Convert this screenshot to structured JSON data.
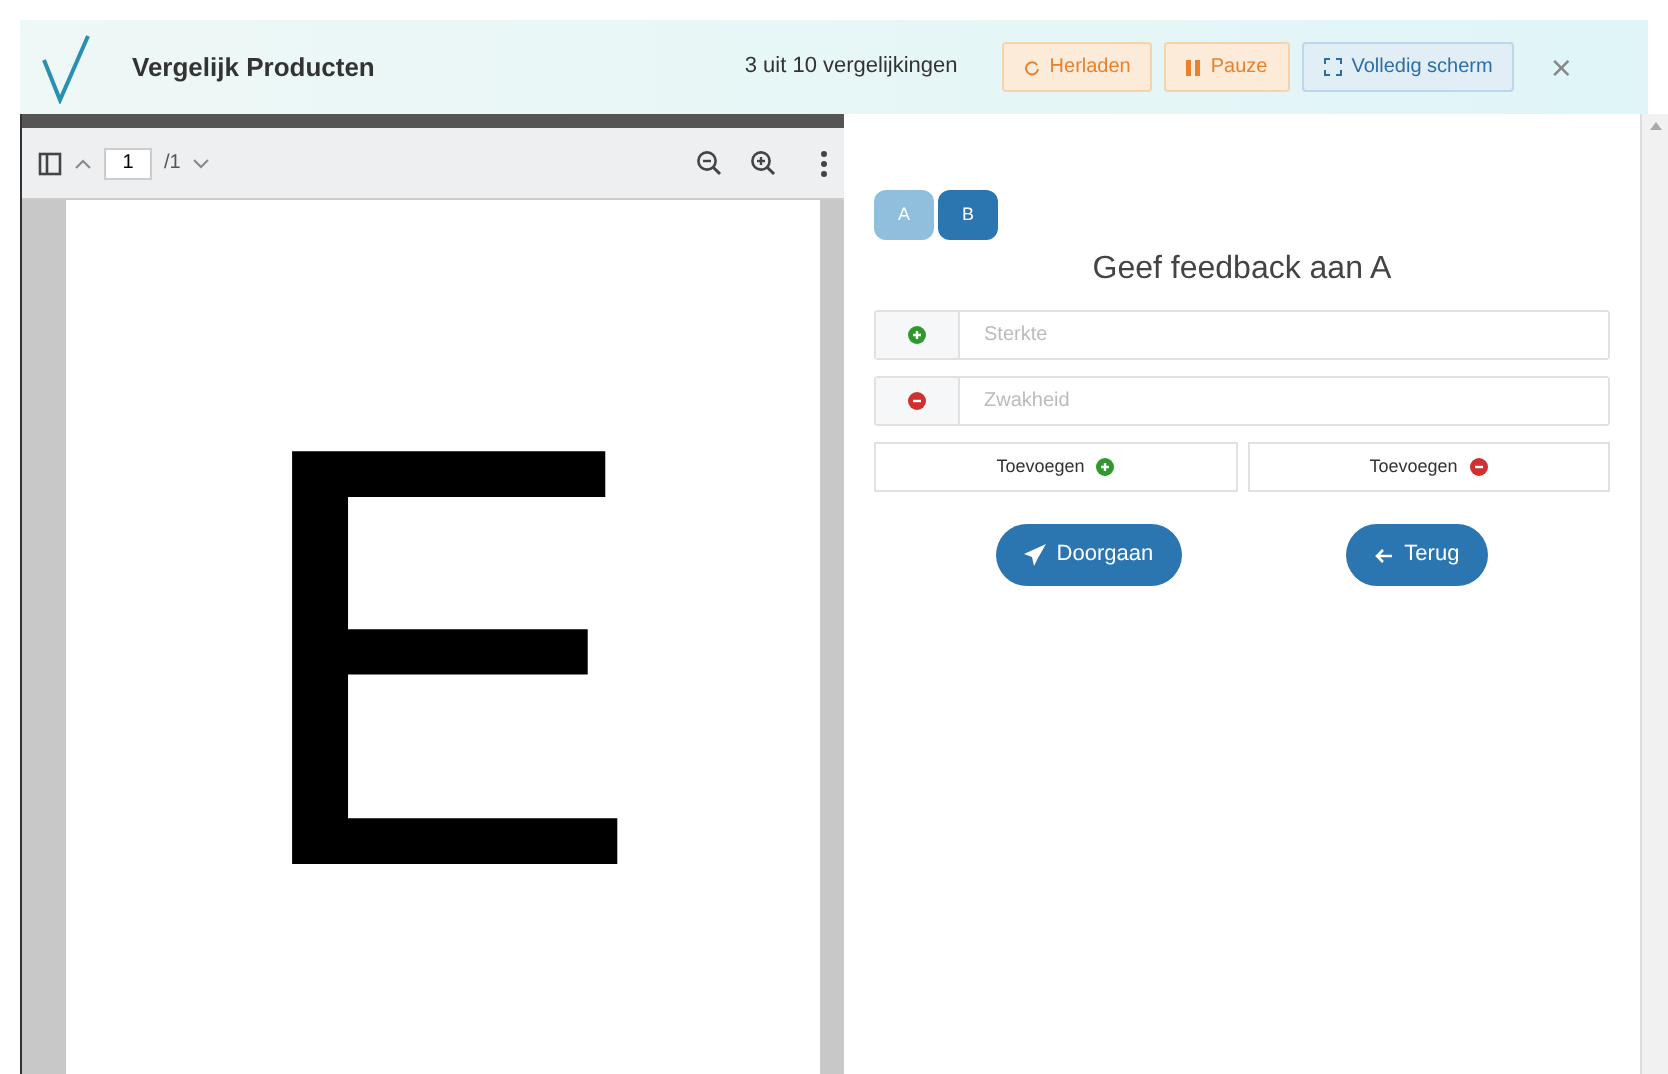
{
  "header": {
    "title": "Vergelijk Producten",
    "progress": "3 uit 10 vergelijkingen",
    "buttons": [
      {
        "kind": "reload",
        "label": "Herladen"
      },
      {
        "kind": "pause",
        "label": "Pauze"
      },
      {
        "kind": "fullscreen",
        "label": "Volledig scherm"
      }
    ],
    "close": "×"
  },
  "pdf_viewer": {
    "page_input": "1",
    "page_total": "/1",
    "page_content": "E"
  },
  "feedback": {
    "tabs": [
      {
        "label": "A",
        "selected": true
      },
      {
        "label": "B",
        "selected": false
      }
    ],
    "heading": "Geef feedback aan A",
    "fields": [
      {
        "kind": "plus",
        "placeholder": "Sterkte"
      },
      {
        "kind": "minus",
        "placeholder": "Zwakheid"
      }
    ],
    "add_buttons": [
      {
        "kind": "plus",
        "label": "Toevoegen"
      },
      {
        "kind": "minus",
        "label": "Toevoegen"
      }
    ],
    "actions": [
      {
        "kind": "send",
        "label": "Doorgaan"
      },
      {
        "kind": "back",
        "label": "Terug"
      }
    ]
  }
}
